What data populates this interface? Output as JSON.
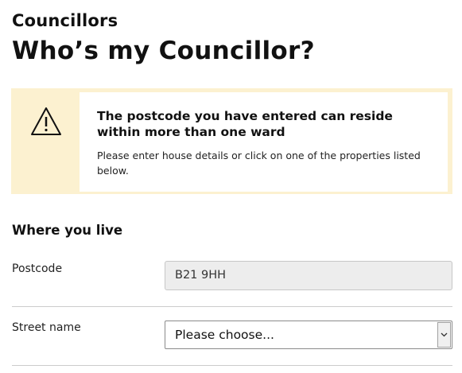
{
  "header": {
    "section_label": "Councillors",
    "title": "Who’s my Councillor?"
  },
  "warning": {
    "icon": "warning-triangle-icon",
    "heading": "The postcode you have entered can reside within more than one ward",
    "text": "Please enter house details or click on one of the properties listed below.",
    "accent_color": "#fcf1d0"
  },
  "form": {
    "legend": "Where you live",
    "postcode": {
      "label": "Postcode",
      "value": "B21 9HH"
    },
    "street": {
      "label": "Street name",
      "selected": "Please choose...",
      "arrow_icon": "chevron-down-icon"
    }
  }
}
